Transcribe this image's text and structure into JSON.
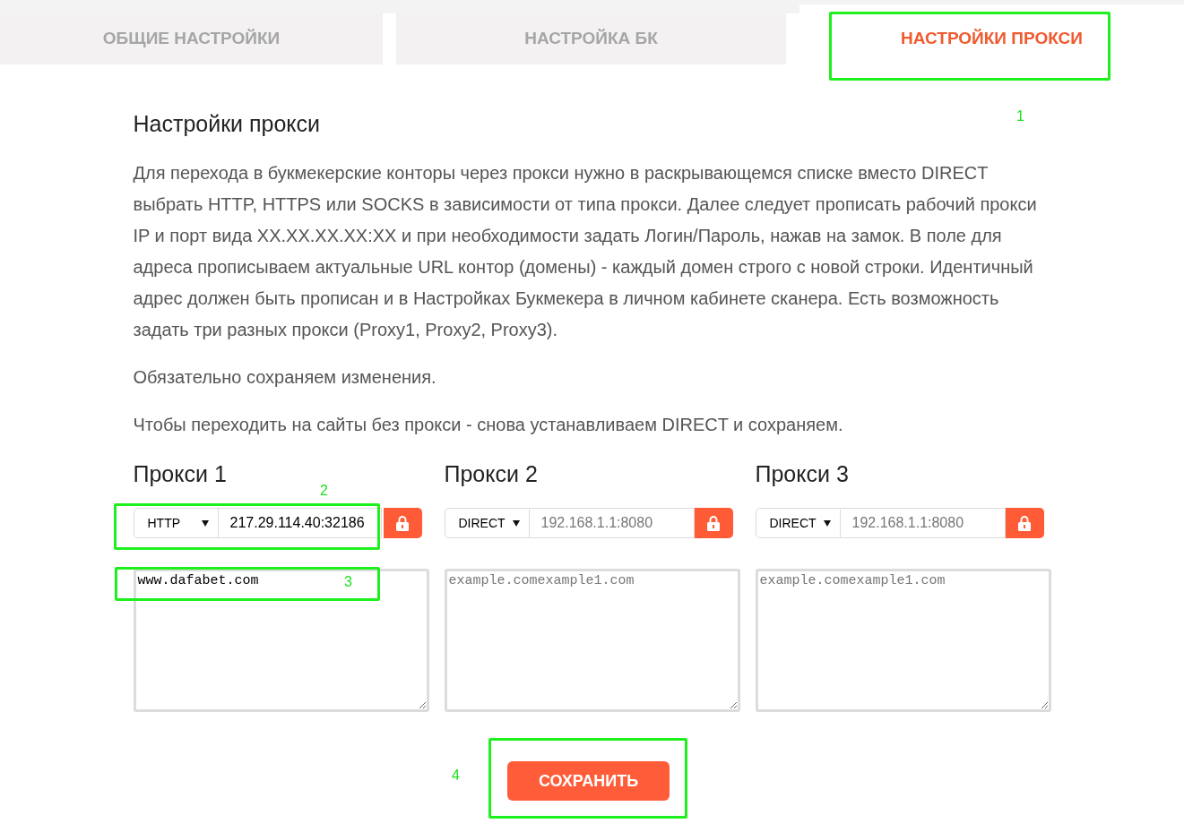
{
  "tabs": [
    {
      "label": "ОБЩИЕ НАСТРОЙКИ",
      "selected": false
    },
    {
      "label": "НАСТРОЙКА БК",
      "selected": false
    },
    {
      "label": "НАСТРОЙКИ ПРОКСИ",
      "selected": true
    }
  ],
  "section": {
    "title": "Настройки прокси",
    "paragraphs": [
      "Для перехода в букмекерские конторы через прокси нужно в раскрывающемся списке вместо DIRECT выбрать HTTP, HTTPS или SOCKS в зависимости от типа прокси. Далее следует прописать рабочий прокси IP и порт вида XX.XX.XX.XX:XX и при необходимости задать Логин/Пароль, нажав на замок. В поле для адреса прописываем актуальные URL контор (домены) - каждый домен строго с новой строки. Идентичный адрес должен быть прописан и в Настройках Букмекера в личном кабинете сканера. Есть возможность задать три разных прокси (Proxy1, Proxy2, Proxy3).",
      "Обязательно сохраняем изменения.",
      "Чтобы переходить на сайты без прокси - снова устанавливаем DIRECT и сохраняем."
    ]
  },
  "proxies": [
    {
      "title": "Прокси 1",
      "protocol": "HTTP",
      "address": {
        "value": "217.29.114.40:32186"
      },
      "domains": {
        "value": "www.dafabet.com"
      }
    },
    {
      "title": "Прокси 2",
      "protocol": "DIRECT",
      "address": {
        "placeholder": "192.168.1.1:8080"
      },
      "domains": {
        "placeholder": "example.comexample1.com"
      }
    },
    {
      "title": "Прокси 3",
      "protocol": "DIRECT",
      "address": {
        "placeholder": "192.168.1.1:8080"
      },
      "domains": {
        "placeholder": "example.comexample1.com"
      }
    }
  ],
  "save_button": "СОХРАНИТЬ",
  "annotations": [
    {
      "label": "1"
    },
    {
      "label": "2"
    },
    {
      "label": "3"
    },
    {
      "label": "4"
    }
  ]
}
